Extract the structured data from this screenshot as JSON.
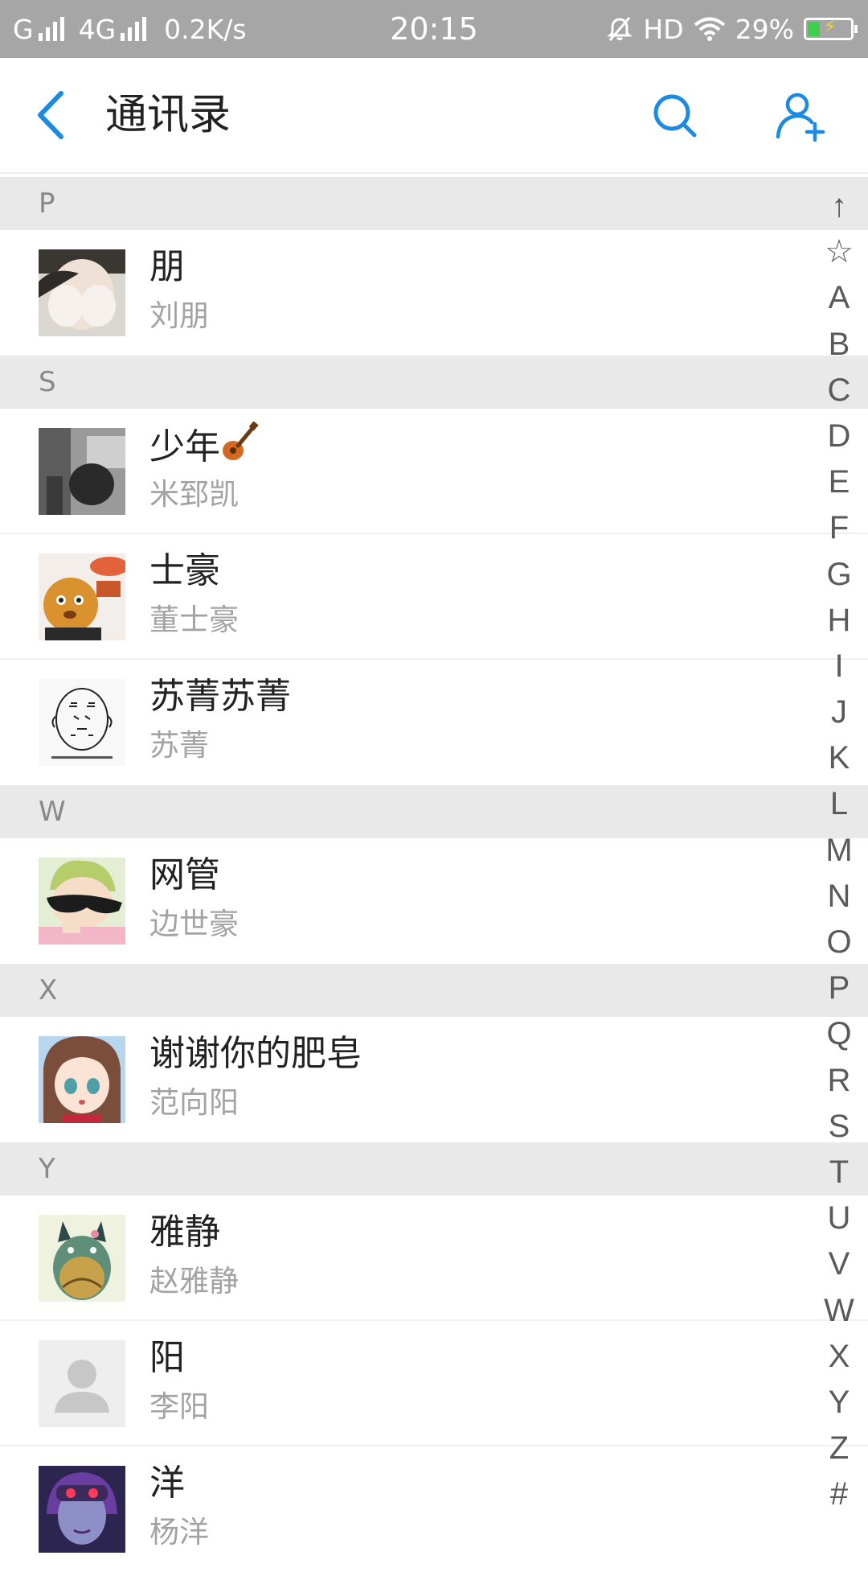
{
  "status_bar": {
    "carrier1": "G",
    "carrier2": "4G",
    "speed": "0.2K/s",
    "time": "20:15",
    "hd": "HD",
    "battery": "29%",
    "battery_level": 0.29,
    "icons": [
      "signal-icon",
      "alarm-off-icon",
      "wifi-icon",
      "battery-icon"
    ]
  },
  "header": {
    "title": "通讯录",
    "icons": [
      "back-arrow-icon",
      "search-icon",
      "add-contact-icon"
    ],
    "accent": "#1a8ae2"
  },
  "sections": [
    {
      "letter": "P",
      "contacts": [
        {
          "name": "朋",
          "sub": "刘朋"
        }
      ]
    },
    {
      "letter": "S",
      "contacts": [
        {
          "name": "少年",
          "sub": "米郅凯"
        },
        {
          "name": "士豪",
          "sub": "董士豪"
        },
        {
          "name": "苏菁苏菁",
          "sub": "苏菁"
        }
      ]
    },
    {
      "letter": "W",
      "contacts": [
        {
          "name": "网管",
          "sub": "边世豪"
        }
      ]
    },
    {
      "letter": "X",
      "contacts": [
        {
          "name": "谢谢你的肥皂",
          "sub": "范向阳"
        }
      ]
    },
    {
      "letter": "Y",
      "contacts": [
        {
          "name": "雅静",
          "sub": "赵雅静"
        },
        {
          "name": "阳",
          "sub": "李阳"
        },
        {
          "name": "洋",
          "sub": "杨洋"
        }
      ]
    }
  ],
  "index": [
    "↑",
    "☆",
    "A",
    "B",
    "C",
    "D",
    "E",
    "F",
    "G",
    "H",
    "I",
    "J",
    "K",
    "L",
    "M",
    "N",
    "O",
    "P",
    "Q",
    "R",
    "S",
    "T",
    "U",
    "V",
    "W",
    "X",
    "Y",
    "Z",
    "#"
  ]
}
